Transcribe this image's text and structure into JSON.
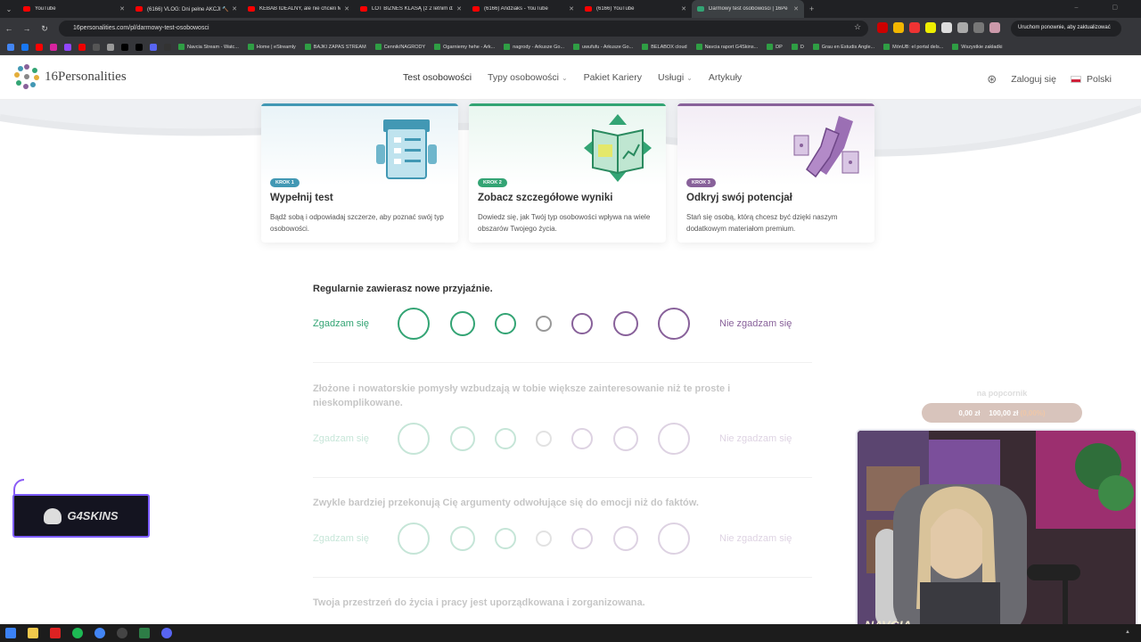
{
  "browser": {
    "tabs": [
      {
        "title": "YouTube",
        "color": "#ff0000",
        "active": false
      },
      {
        "title": "(6166) VLOG: Dni pełne AKCJI 🔨",
        "color": "#ff0000",
        "active": false
      },
      {
        "title": "KEBAB IDEALNY, ale nie chcieli M",
        "color": "#ff0000",
        "active": false
      },
      {
        "title": "LOT BIZNES KLASĄ (z 2 letnim dz",
        "color": "#ff0000",
        "active": false
      },
      {
        "title": "(6166) Andziaks - YouTube",
        "color": "#ff0000",
        "active": false
      },
      {
        "title": "(6166) YouTube",
        "color": "#ff0000",
        "active": false
      },
      {
        "title": "Darmowy test osobowości | 16Pe",
        "color": "#33a474",
        "active": true
      }
    ],
    "url": "16personalities.com/pl/darmowy-test-osobowosci",
    "restart_label": "Uruchom ponownie, aby zaktualizować",
    "bookmarks": [
      "Navcia Stream - Watc...",
      "Home | eStreamly",
      "BAJKI ZAPAS STREAM",
      "Cennik/NAGRODY",
      "Ogarniemy hehe - Ark...",
      "nagrody - Arkusze Go...",
      "uwufufu - Arkusze Go...",
      "BELABOX cloud",
      "Navcia raport G4Skins...",
      "DP",
      "D",
      "Grau en Estudis Angle...",
      "MónUB: el portal dels...",
      "Wszystkie zakładki"
    ]
  },
  "site": {
    "logo": "16Personalities",
    "nav": [
      "Test osobowości",
      "Typy osobowości",
      "Pakiet Kariery",
      "Usługi",
      "Artykuły"
    ],
    "login": "Zaloguj się",
    "language": "Polski"
  },
  "steps": [
    {
      "badge": "KROK 1",
      "title": "Wypełnij test",
      "desc": "Bądź sobą i odpowiadaj szczerze, aby poznać swój typ osobowości.",
      "color": "#4298b4"
    },
    {
      "badge": "KROK 2",
      "title": "Zobacz szczegółowe wyniki",
      "desc": "Dowiedz się, jak Twój typ osobowości wpływa na wiele obszarów Twojego życia.",
      "color": "#33a474"
    },
    {
      "badge": "KROK 3",
      "title": "Odkryj swój potencjał",
      "desc": "Stań się osobą, którą chcesz być dzięki naszym dodatkowym materiałom premium.",
      "color": "#88619a"
    }
  ],
  "questions": [
    "Regularnie zawierasz nowe przyjaźnie.",
    "Złożone i nowatorskie pomysły wzbudzają w tobie większe zainteresowanie niż te proste i nieskomplikowane.",
    "Zwykle bardziej przekonują Cię argumenty odwołujące się do emocji niż do faktów.",
    "Twoja przestrzeń do życia i pracy jest uporządkowana i zorganizowana."
  ],
  "scale": {
    "agree": "Zgadzam się",
    "disagree": "Nie zgadzam się",
    "agree_color": "#33a474",
    "disagree_color": "#88619a"
  },
  "overlay": {
    "goal_label": "na popcornik",
    "amount_current": "0,00 zł",
    "amount_target": "100,00 zł",
    "amount_percent": "(0,00%)",
    "sponsor": "G4SKINS",
    "streamer": "NAVCIA"
  }
}
